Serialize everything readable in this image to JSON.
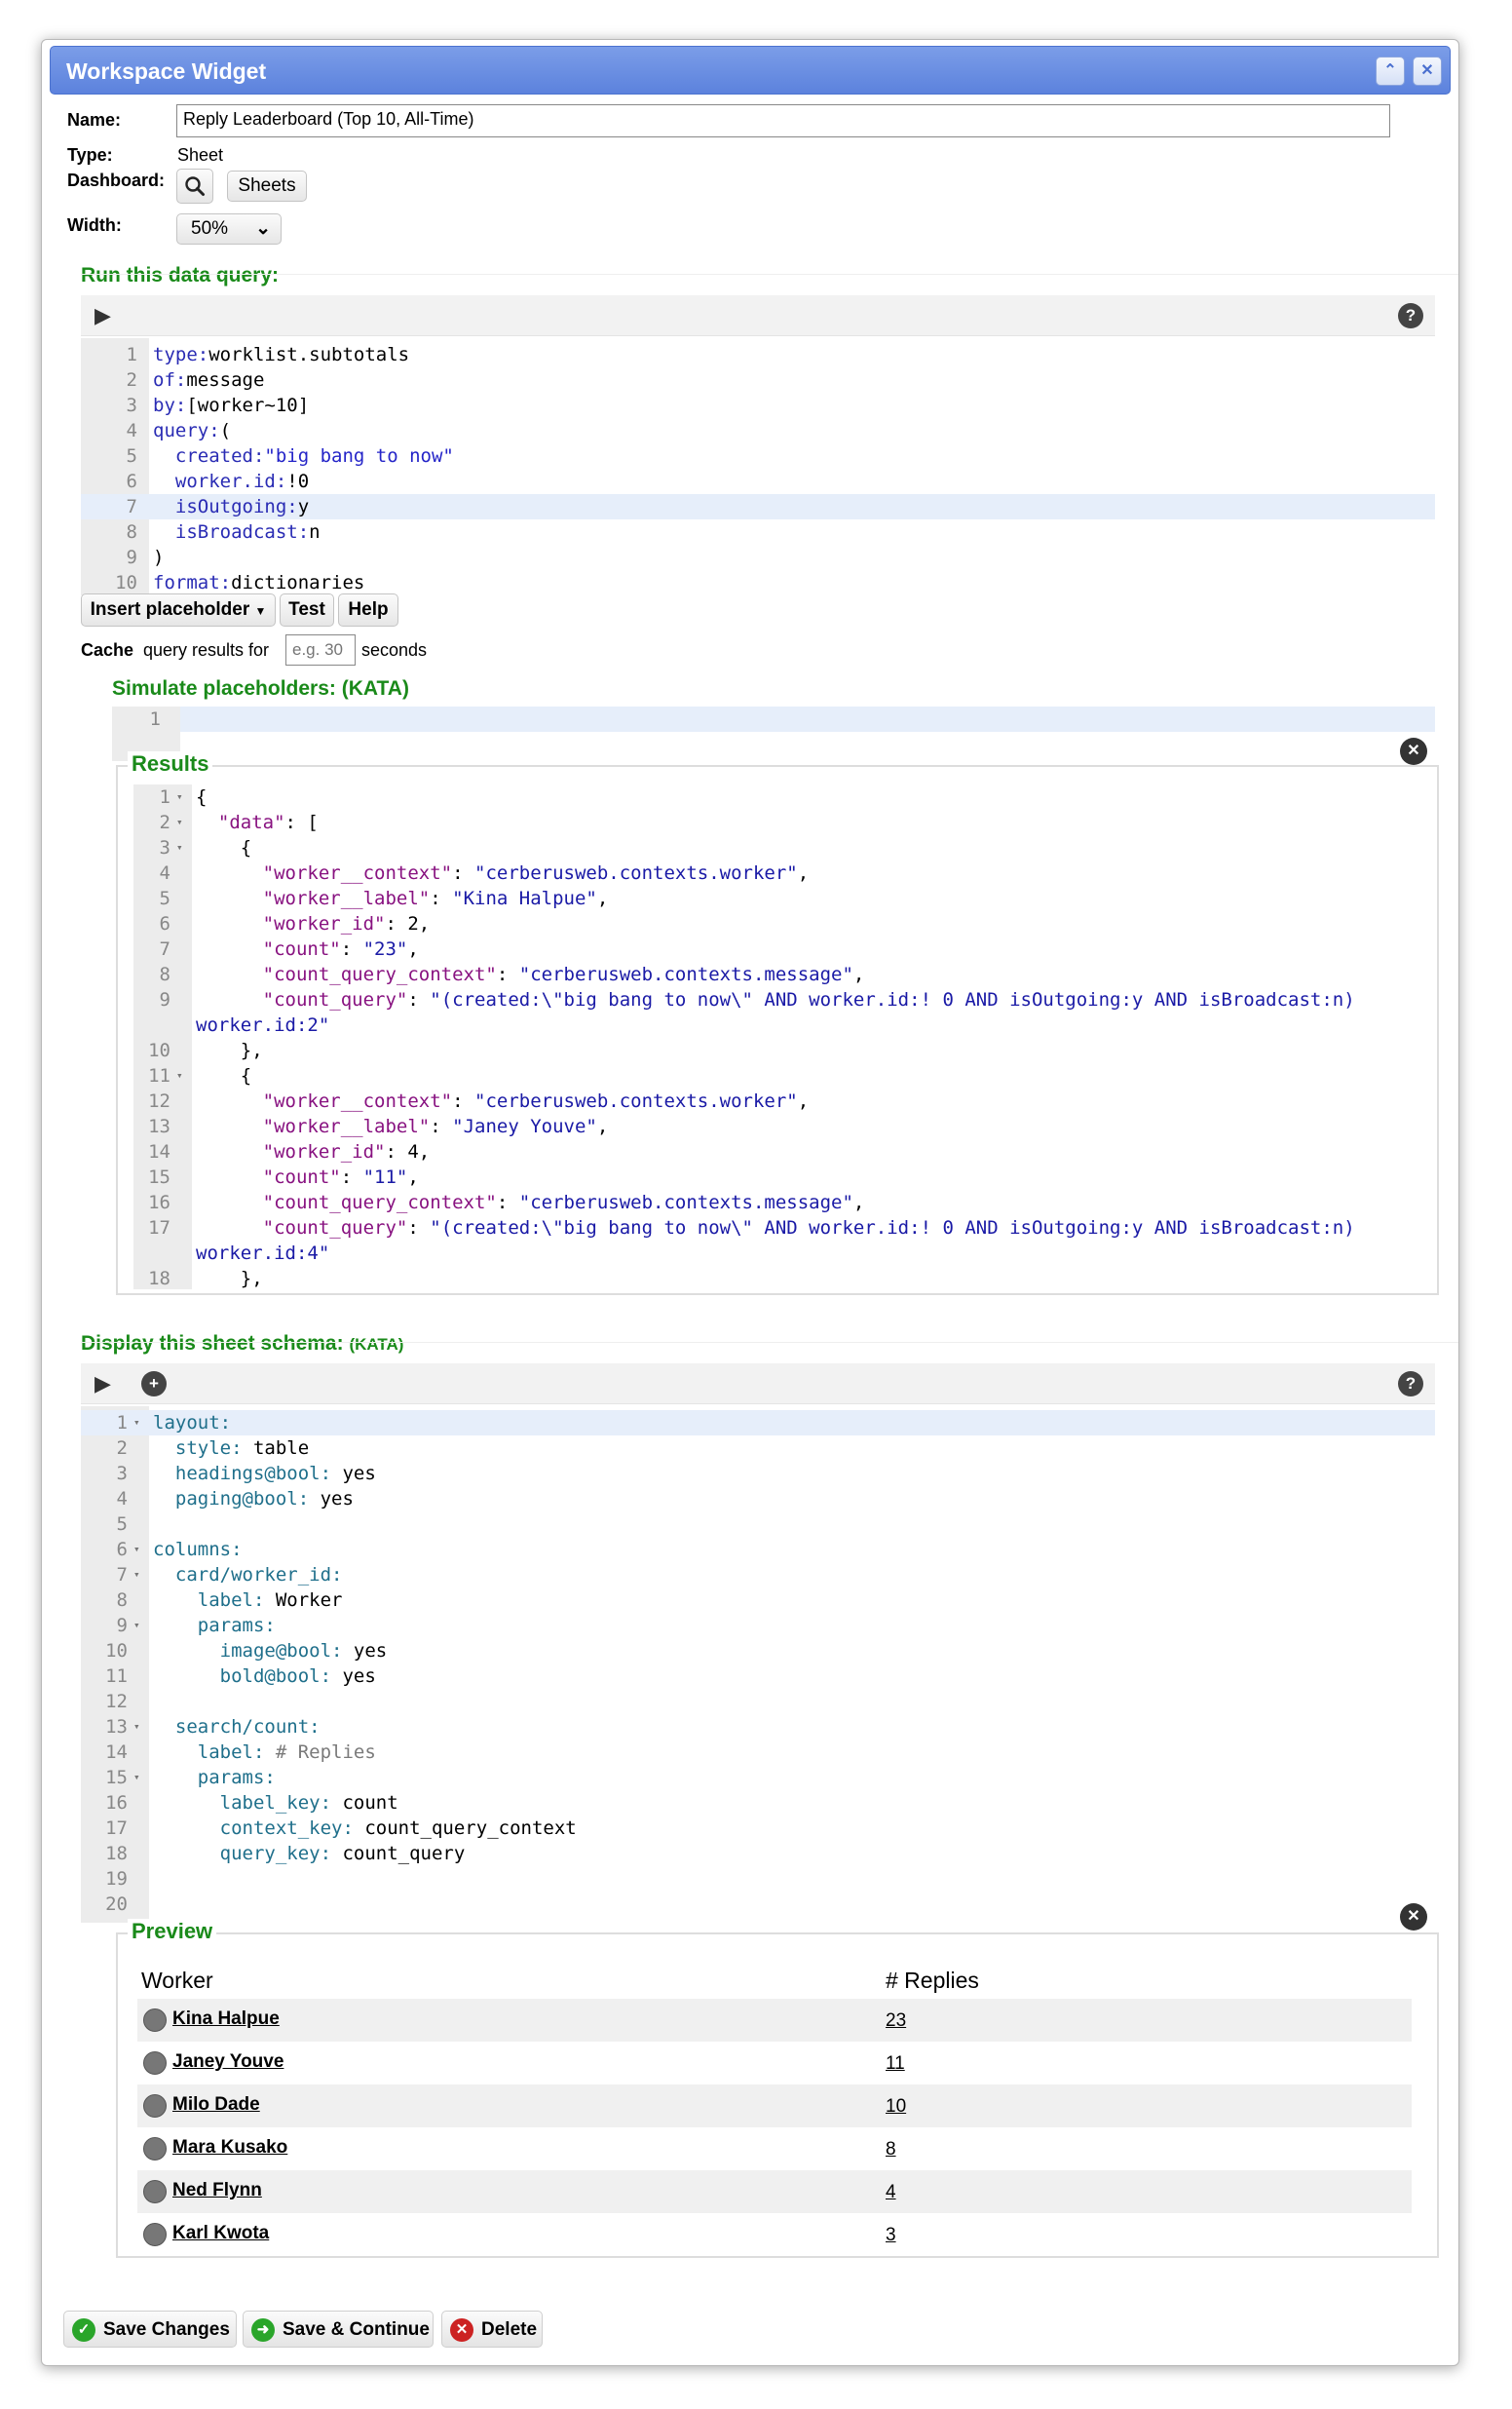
{
  "window": {
    "title": "Workspace Widget"
  },
  "form": {
    "name_label": "Name:",
    "name_value": "Reply Leaderboard (Top 10, All-Time)",
    "type_label": "Type:",
    "type_value": "Sheet",
    "dashboard_label": "Dashboard:",
    "sheets_button": "Sheets",
    "width_label": "Width:",
    "width_value": "50%"
  },
  "query_section": {
    "title": "Run this data query:",
    "lines": [
      {
        "n": "1",
        "parts": [
          [
            "k",
            "type:"
          ],
          [
            "",
            "worklist.subtotals"
          ]
        ]
      },
      {
        "n": "2",
        "parts": [
          [
            "k",
            "of:"
          ],
          [
            "",
            "message"
          ]
        ]
      },
      {
        "n": "3",
        "parts": [
          [
            "k",
            "by:"
          ],
          [
            "",
            "[worker~10]"
          ]
        ]
      },
      {
        "n": "4",
        "parts": [
          [
            "k",
            "query:"
          ],
          [
            "",
            "("
          ]
        ]
      },
      {
        "n": "5",
        "parts": [
          [
            "",
            "  "
          ],
          [
            "k",
            "created:"
          ],
          [
            "s",
            "\"big bang to now\""
          ]
        ]
      },
      {
        "n": "6",
        "parts": [
          [
            "",
            "  "
          ],
          [
            "k",
            "worker.id:"
          ],
          [
            "",
            "!0"
          ]
        ]
      },
      {
        "n": "7",
        "parts": [
          [
            "",
            "  "
          ],
          [
            "k",
            "isOutgoing:"
          ],
          [
            "",
            "y"
          ]
        ]
      },
      {
        "n": "8",
        "parts": [
          [
            "",
            "  "
          ],
          [
            "k",
            "isBroadcast:"
          ],
          [
            "",
            "n"
          ]
        ]
      },
      {
        "n": "9",
        "parts": [
          [
            "",
            ")"
          ]
        ]
      },
      {
        "n": "10",
        "parts": [
          [
            "k",
            "format:"
          ],
          [
            "",
            "dictionaries"
          ]
        ]
      }
    ],
    "insert_placeholder": "Insert placeholder",
    "test_button": "Test",
    "help_button": "Help",
    "cache_bold": "Cache",
    "cache_text": "query results for",
    "cache_placeholder": "e.g. 30",
    "cache_suffix": "seconds"
  },
  "simulate": {
    "title": "Simulate placeholders:",
    "title_suffix": "(KATA)",
    "line": "1"
  },
  "results": {
    "legend": "Results",
    "lines": [
      {
        "n": "1",
        "f": true,
        "parts": [
          [
            "",
            "{"
          ]
        ]
      },
      {
        "n": "2",
        "f": true,
        "parts": [
          [
            "",
            "  "
          ],
          [
            "jk",
            "\"data\""
          ],
          [
            "",
            ": ["
          ]
        ]
      },
      {
        "n": "3",
        "f": true,
        "parts": [
          [
            "",
            "    {"
          ]
        ]
      },
      {
        "n": "4",
        "parts": [
          [
            "",
            "      "
          ],
          [
            "jk",
            "\"worker__context\""
          ],
          [
            "",
            ": "
          ],
          [
            "js",
            "\"cerberusweb.contexts.worker\""
          ],
          [
            "",
            ","
          ]
        ]
      },
      {
        "n": "5",
        "parts": [
          [
            "",
            "      "
          ],
          [
            "jk",
            "\"worker__label\""
          ],
          [
            "",
            ": "
          ],
          [
            "js",
            "\"Kina Halpue\""
          ],
          [
            "",
            ","
          ]
        ]
      },
      {
        "n": "6",
        "parts": [
          [
            "",
            "      "
          ],
          [
            "jk",
            "\"worker_id\""
          ],
          [
            "",
            ": 2,"
          ]
        ]
      },
      {
        "n": "7",
        "parts": [
          [
            "",
            "      "
          ],
          [
            "jk",
            "\"count\""
          ],
          [
            "",
            ": "
          ],
          [
            "js",
            "\"23\""
          ],
          [
            "",
            ","
          ]
        ]
      },
      {
        "n": "8",
        "parts": [
          [
            "",
            "      "
          ],
          [
            "jk",
            "\"count_query_context\""
          ],
          [
            "",
            ": "
          ],
          [
            "js",
            "\"cerberusweb.contexts.message\""
          ],
          [
            "",
            ","
          ]
        ]
      },
      {
        "n": "9",
        "parts": [
          [
            "",
            "      "
          ],
          [
            "jk",
            "\"count_query\""
          ],
          [
            "",
            ": "
          ],
          [
            "js",
            "\"(created:\\\"big bang to now\\\" AND worker.id:! 0 AND isOutgoing:y AND isBroadcast:n)"
          ]
        ]
      },
      {
        "n": "",
        "parts": [
          [
            "js",
            "worker.id:2\""
          ]
        ]
      },
      {
        "n": "10",
        "parts": [
          [
            "",
            "    },"
          ]
        ]
      },
      {
        "n": "11",
        "f": true,
        "parts": [
          [
            "",
            "    {"
          ]
        ]
      },
      {
        "n": "12",
        "parts": [
          [
            "",
            "      "
          ],
          [
            "jk",
            "\"worker__context\""
          ],
          [
            "",
            ": "
          ],
          [
            "js",
            "\"cerberusweb.contexts.worker\""
          ],
          [
            "",
            ","
          ]
        ]
      },
      {
        "n": "13",
        "parts": [
          [
            "",
            "      "
          ],
          [
            "jk",
            "\"worker__label\""
          ],
          [
            "",
            ": "
          ],
          [
            "js",
            "\"Janey Youve\""
          ],
          [
            "",
            ","
          ]
        ]
      },
      {
        "n": "14",
        "parts": [
          [
            "",
            "      "
          ],
          [
            "jk",
            "\"worker_id\""
          ],
          [
            "",
            ": 4,"
          ]
        ]
      },
      {
        "n": "15",
        "parts": [
          [
            "",
            "      "
          ],
          [
            "jk",
            "\"count\""
          ],
          [
            "",
            ": "
          ],
          [
            "js",
            "\"11\""
          ],
          [
            "",
            ","
          ]
        ]
      },
      {
        "n": "16",
        "parts": [
          [
            "",
            "      "
          ],
          [
            "jk",
            "\"count_query_context\""
          ],
          [
            "",
            ": "
          ],
          [
            "js",
            "\"cerberusweb.contexts.message\""
          ],
          [
            "",
            ","
          ]
        ]
      },
      {
        "n": "17",
        "parts": [
          [
            "",
            "      "
          ],
          [
            "jk",
            "\"count_query\""
          ],
          [
            "",
            ": "
          ],
          [
            "js",
            "\"(created:\\\"big bang to now\\\" AND worker.id:! 0 AND isOutgoing:y AND isBroadcast:n)"
          ]
        ]
      },
      {
        "n": "",
        "parts": [
          [
            "js",
            "worker.id:4\""
          ]
        ]
      },
      {
        "n": "18",
        "parts": [
          [
            "",
            "    },"
          ]
        ]
      }
    ]
  },
  "schema": {
    "title": "Display this sheet schema:",
    "title_suffix": "(KATA)",
    "lines": [
      {
        "n": "1",
        "f": true,
        "parts": [
          [
            "kt",
            "layout:"
          ]
        ]
      },
      {
        "n": "2",
        "parts": [
          [
            "",
            "  "
          ],
          [
            "kt",
            "style:"
          ],
          [
            "",
            " table"
          ]
        ]
      },
      {
        "n": "3",
        "parts": [
          [
            "",
            "  "
          ],
          [
            "kt",
            "headings@bool:"
          ],
          [
            "",
            " yes"
          ]
        ]
      },
      {
        "n": "4",
        "parts": [
          [
            "",
            "  "
          ],
          [
            "kt",
            "paging@bool:"
          ],
          [
            "",
            " yes"
          ]
        ]
      },
      {
        "n": "5",
        "parts": []
      },
      {
        "n": "6",
        "f": true,
        "parts": [
          [
            "kt",
            "columns:"
          ]
        ]
      },
      {
        "n": "7",
        "f": true,
        "parts": [
          [
            "",
            "  "
          ],
          [
            "kt",
            "card/worker_id:"
          ]
        ]
      },
      {
        "n": "8",
        "parts": [
          [
            "",
            "    "
          ],
          [
            "kt",
            "label:"
          ],
          [
            "",
            " Worker"
          ]
        ]
      },
      {
        "n": "9",
        "f": true,
        "parts": [
          [
            "",
            "    "
          ],
          [
            "kt",
            "params:"
          ]
        ]
      },
      {
        "n": "10",
        "parts": [
          [
            "",
            "      "
          ],
          [
            "kt",
            "image@bool:"
          ],
          [
            "",
            " yes"
          ]
        ]
      },
      {
        "n": "11",
        "parts": [
          [
            "",
            "      "
          ],
          [
            "kt",
            "bold@bool:"
          ],
          [
            "",
            " yes"
          ]
        ]
      },
      {
        "n": "12",
        "parts": []
      },
      {
        "n": "13",
        "f": true,
        "parts": [
          [
            "",
            "  "
          ],
          [
            "kt",
            "search/count:"
          ]
        ]
      },
      {
        "n": "14",
        "parts": [
          [
            "",
            "    "
          ],
          [
            "kt",
            "label:"
          ],
          [
            "cm",
            " # Replies"
          ]
        ]
      },
      {
        "n": "15",
        "f": true,
        "parts": [
          [
            "",
            "    "
          ],
          [
            "kt",
            "params:"
          ]
        ]
      },
      {
        "n": "16",
        "parts": [
          [
            "",
            "      "
          ],
          [
            "kt",
            "label_key:"
          ],
          [
            "",
            " count"
          ]
        ]
      },
      {
        "n": "17",
        "parts": [
          [
            "",
            "      "
          ],
          [
            "kt",
            "context_key:"
          ],
          [
            "",
            " count_query_context"
          ]
        ]
      },
      {
        "n": "18",
        "parts": [
          [
            "",
            "      "
          ],
          [
            "kt",
            "query_key:"
          ],
          [
            "",
            " count_query"
          ]
        ]
      },
      {
        "n": "19",
        "parts": []
      },
      {
        "n": "20",
        "parts": []
      }
    ]
  },
  "preview": {
    "legend": "Preview",
    "col_worker": "Worker",
    "col_replies": "# Replies",
    "rows": [
      {
        "worker": "Kina Halpue",
        "replies": "23"
      },
      {
        "worker": "Janey Youve",
        "replies": "11"
      },
      {
        "worker": "Milo Dade",
        "replies": "10"
      },
      {
        "worker": "Mara Kusako",
        "replies": "8"
      },
      {
        "worker": "Ned Flynn",
        "replies": "4"
      },
      {
        "worker": "Karl Kwota",
        "replies": "3"
      }
    ]
  },
  "footer": {
    "save": "Save Changes",
    "save_continue": "Save & Continue",
    "delete": "Delete"
  },
  "icons": {
    "minimize": "chevron-up-icon",
    "close": "close-icon",
    "search": "search-icon",
    "run": "play-icon",
    "help": "help-icon",
    "add": "plus-icon"
  },
  "colors": {
    "title_bar": "#5c82dd",
    "section": "#1a8a1a",
    "ok": "#2aa52a",
    "danger": "#cc2222",
    "highlight": "#e6eefa"
  }
}
